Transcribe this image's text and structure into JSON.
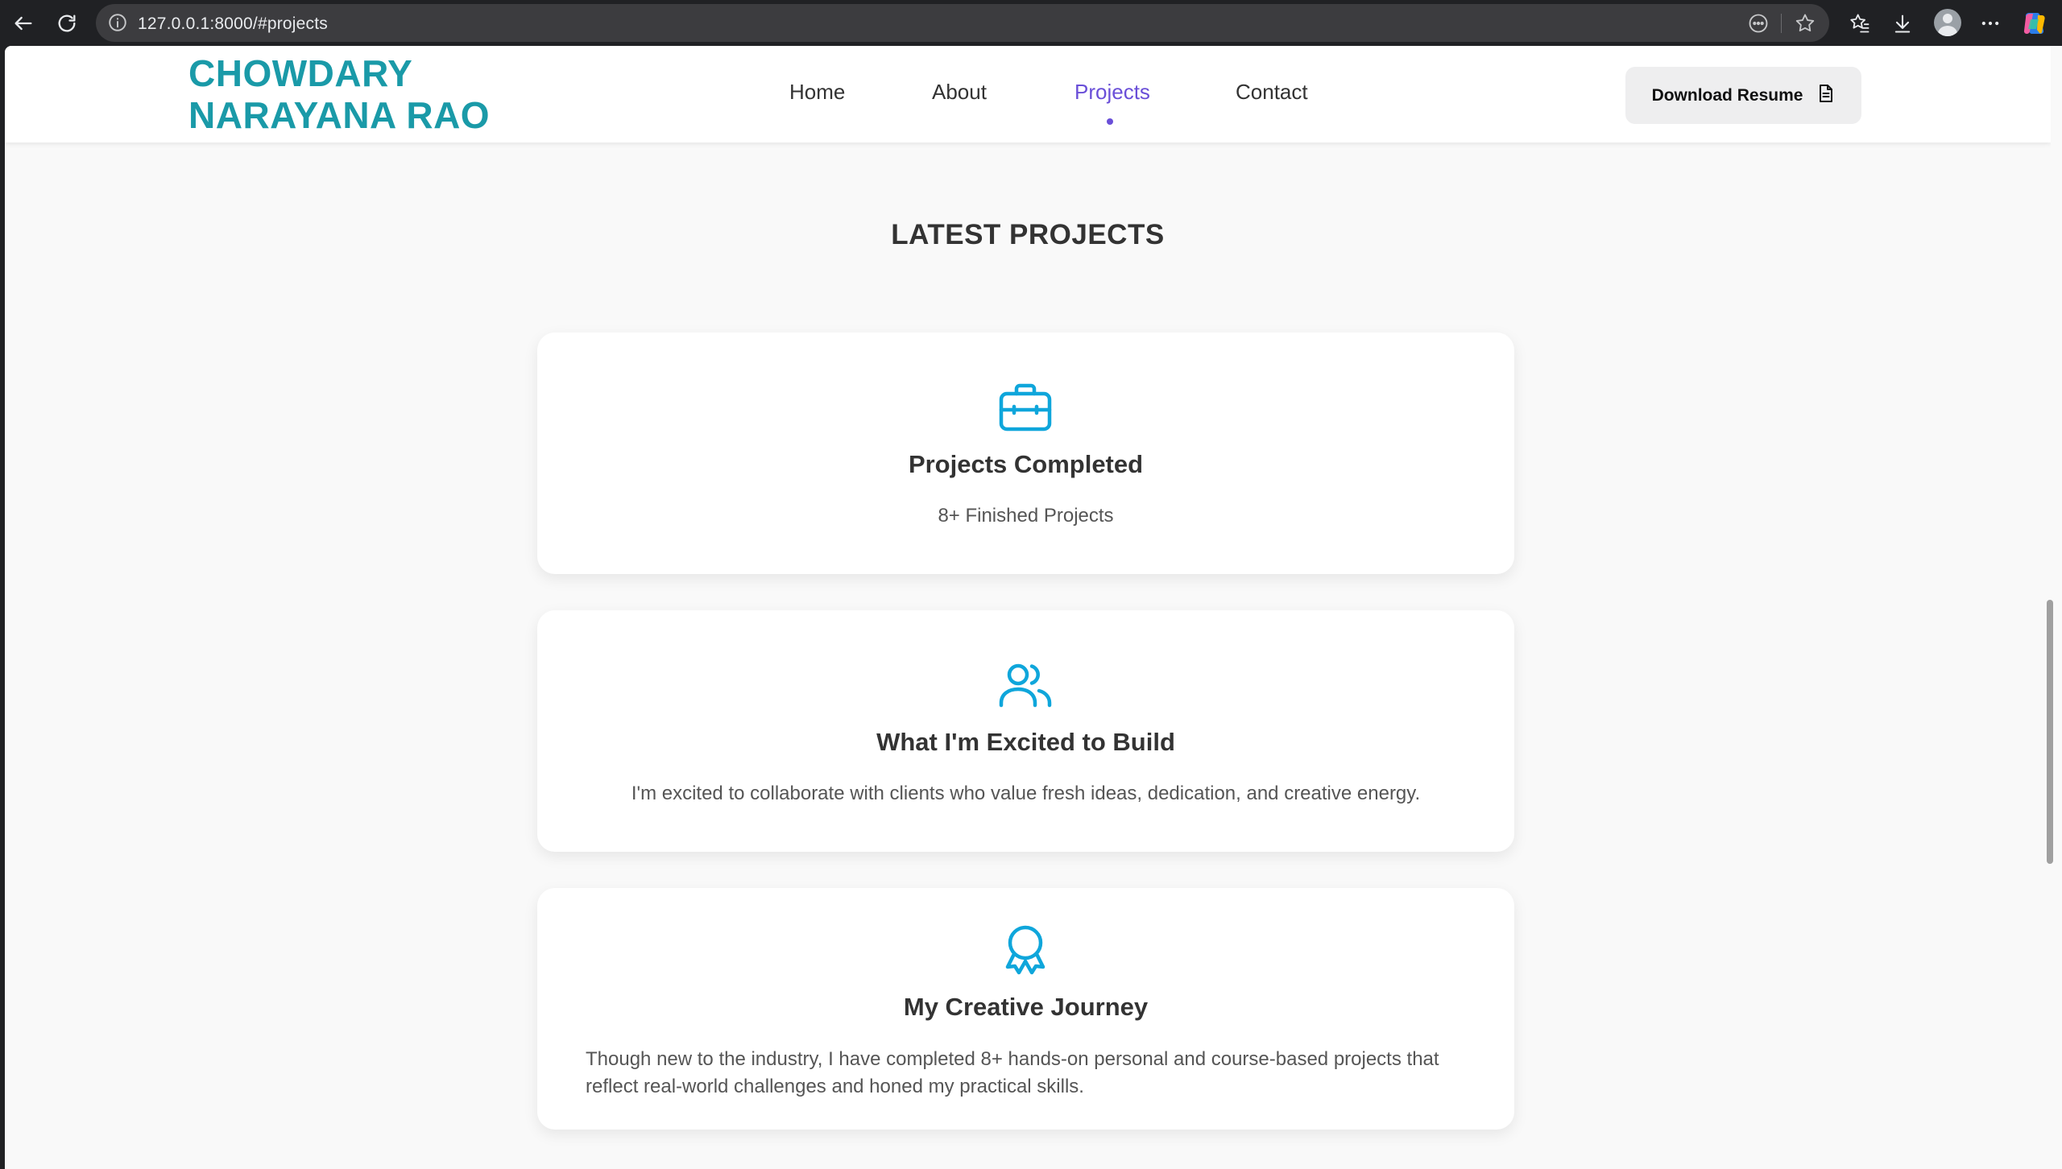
{
  "browser": {
    "url": "127.0.0.1:8000/#projects"
  },
  "site": {
    "brand_line1": "CHOWDARY",
    "brand_line2": "NARAYANA RAO",
    "nav": [
      {
        "label": "Home"
      },
      {
        "label": "About"
      },
      {
        "label": "Projects",
        "active": true
      },
      {
        "label": "Contact"
      }
    ],
    "resume_label": "Download Resume"
  },
  "section": {
    "title": "LATEST PROJECTS",
    "cards": [
      {
        "icon": "briefcase-icon",
        "title": "Projects Completed",
        "text": "8+ Finished Projects"
      },
      {
        "icon": "users-icon",
        "title": "What I'm Excited to Build",
        "text": "I'm excited to collaborate with clients who value fresh ideas, dedication, and creative energy."
      },
      {
        "icon": "award-icon",
        "title": "My Creative Journey",
        "text": "Though new to the industry, I have completed 8+ hands-on personal and course-based projects that reflect real-world challenges and honed my practical skills."
      }
    ]
  },
  "colors": {
    "brand": "#1a9aa8",
    "nav_active": "#6a4fd8",
    "icon_accent": "#0fa6db",
    "page_bg": "#f9f9f9"
  }
}
